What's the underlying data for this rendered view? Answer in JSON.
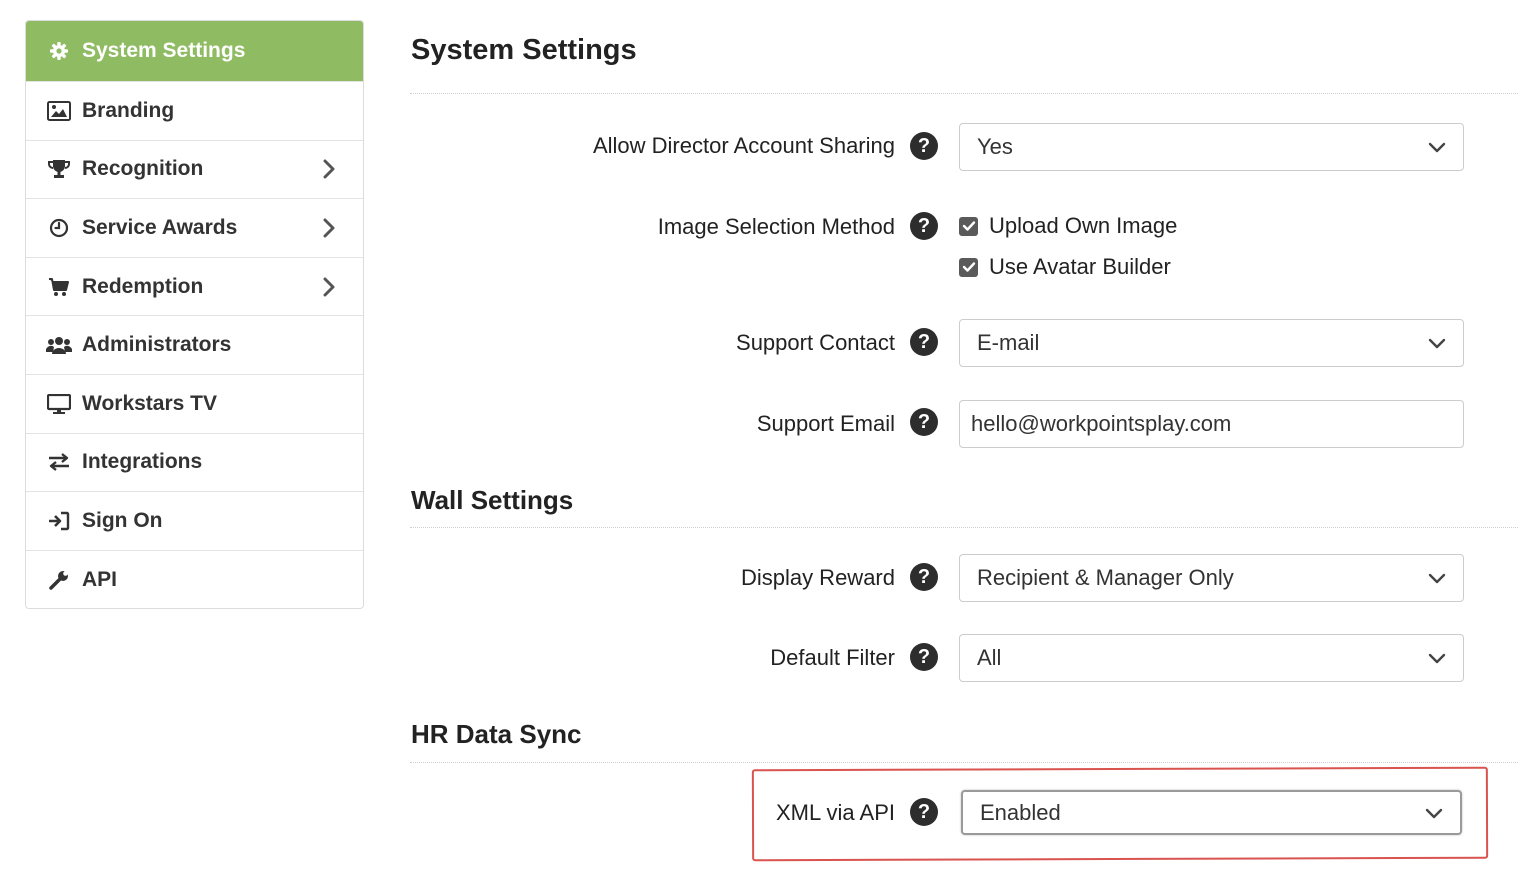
{
  "sidebar": {
    "items": [
      {
        "label": "System Settings",
        "icon": "gear-icon",
        "active": true,
        "has_submenu": false
      },
      {
        "label": "Branding",
        "icon": "image-icon",
        "active": false,
        "has_submenu": false
      },
      {
        "label": "Recognition",
        "icon": "trophy-icon",
        "active": false,
        "has_submenu": true
      },
      {
        "label": "Service Awards",
        "icon": "clock-icon",
        "active": false,
        "has_submenu": true
      },
      {
        "label": "Redemption",
        "icon": "cart-icon",
        "active": false,
        "has_submenu": true
      },
      {
        "label": "Administrators",
        "icon": "users-icon",
        "active": false,
        "has_submenu": false
      },
      {
        "label": "Workstars TV",
        "icon": "monitor-icon",
        "active": false,
        "has_submenu": false
      },
      {
        "label": "Integrations",
        "icon": "exchange-icon",
        "active": false,
        "has_submenu": false
      },
      {
        "label": "Sign On",
        "icon": "sign-in-icon",
        "active": false,
        "has_submenu": false
      },
      {
        "label": "API",
        "icon": "wrench-icon",
        "active": false,
        "has_submenu": false
      }
    ]
  },
  "main": {
    "title": "System Settings",
    "system": {
      "director_sharing": {
        "label": "Allow Director Account Sharing",
        "value": "Yes"
      },
      "image_selection": {
        "label": "Image Selection Method",
        "options": [
          {
            "label": "Upload Own Image",
            "checked": true
          },
          {
            "label": "Use Avatar Builder",
            "checked": true
          }
        ]
      },
      "support_contact": {
        "label": "Support Contact",
        "value": "E-mail"
      },
      "support_email": {
        "label": "Support Email",
        "value": "hello@workpointsplay.com"
      }
    },
    "wall": {
      "title": "Wall Settings",
      "display_reward": {
        "label": "Display Reward",
        "value": "Recipient & Manager Only"
      },
      "default_filter": {
        "label": "Default Filter",
        "value": "All"
      }
    },
    "hr": {
      "title": "HR Data Sync",
      "xml_api": {
        "label": "XML via API",
        "value": "Enabled"
      }
    }
  },
  "help_glyph": "?",
  "colors": {
    "accent": "#8fbc63",
    "highlight": "#d9534f",
    "help": "#2d2d2d"
  }
}
